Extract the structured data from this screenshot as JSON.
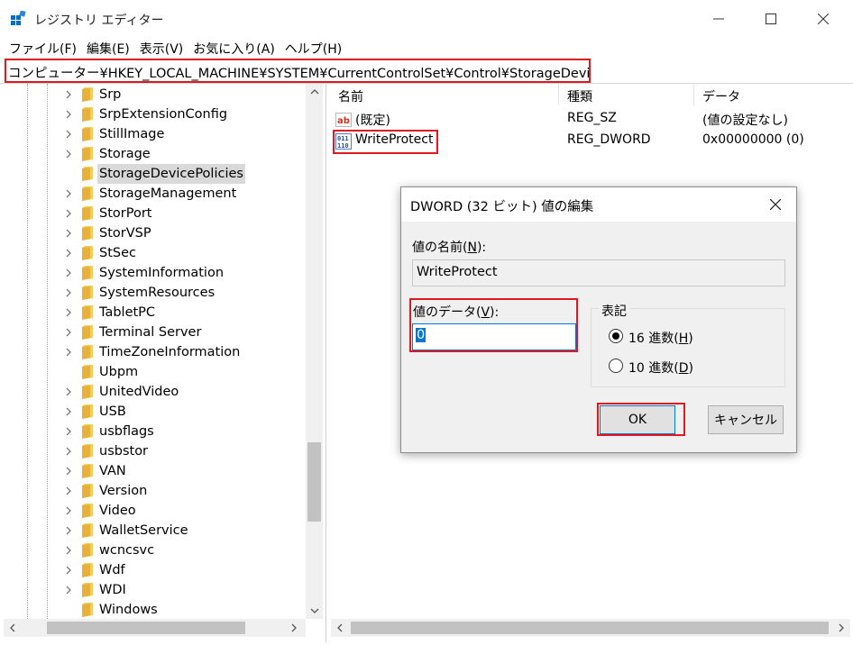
{
  "window": {
    "title": "レジストリ エディター",
    "icon": "regedit-icon"
  },
  "menu": [
    {
      "label": "ファイル(F)"
    },
    {
      "label": "編集(E)"
    },
    {
      "label": "表示(V)"
    },
    {
      "label": "お気に入り(A)"
    },
    {
      "label": "ヘルプ(H)"
    }
  ],
  "address": {
    "path": "コンピューター¥HKEY_LOCAL_MACHINE¥SYSTEM¥CurrentControlSet¥Control¥StorageDevicePolicies"
  },
  "tree": {
    "items": [
      {
        "label": "Srp",
        "expandable": true
      },
      {
        "label": "SrpExtensionConfig",
        "expandable": true
      },
      {
        "label": "StillImage",
        "expandable": true
      },
      {
        "label": "Storage",
        "expandable": true
      },
      {
        "label": "StorageDevicePolicies",
        "expandable": false,
        "selected": true
      },
      {
        "label": "StorageManagement",
        "expandable": true
      },
      {
        "label": "StorPort",
        "expandable": true
      },
      {
        "label": "StorVSP",
        "expandable": true
      },
      {
        "label": "StSec",
        "expandable": true
      },
      {
        "label": "SystemInformation",
        "expandable": true
      },
      {
        "label": "SystemResources",
        "expandable": true
      },
      {
        "label": "TabletPC",
        "expandable": true
      },
      {
        "label": "Terminal Server",
        "expandable": true
      },
      {
        "label": "TimeZoneInformation",
        "expandable": true
      },
      {
        "label": "Ubpm",
        "expandable": false
      },
      {
        "label": "UnitedVideo",
        "expandable": true
      },
      {
        "label": "USB",
        "expandable": true
      },
      {
        "label": "usbflags",
        "expandable": true
      },
      {
        "label": "usbstor",
        "expandable": true
      },
      {
        "label": "VAN",
        "expandable": true
      },
      {
        "label": "Version",
        "expandable": true
      },
      {
        "label": "Video",
        "expandable": true
      },
      {
        "label": "WalletService",
        "expandable": true
      },
      {
        "label": "wcncsvc",
        "expandable": true
      },
      {
        "label": "Wdf",
        "expandable": true
      },
      {
        "label": "WDI",
        "expandable": true
      },
      {
        "label": "Windows",
        "expandable": false
      }
    ]
  },
  "list": {
    "headers": {
      "name": "名前",
      "type": "種類",
      "data": "データ"
    },
    "rows": [
      {
        "icon": "string-value-icon",
        "name": "(既定)",
        "type": "REG_SZ",
        "data": "(値の設定なし)"
      },
      {
        "icon": "binary-value-icon",
        "name": "WriteProtect",
        "type": "REG_DWORD",
        "data": "0x00000000 (0)"
      }
    ]
  },
  "dialog": {
    "title": "DWORD (32 ビット) 値の編集",
    "name_label_pre": "値の名前(",
    "name_label_key": "N",
    "name_label_post": "):",
    "name_value": "WriteProtect",
    "data_label_pre": "値のデータ(",
    "data_label_key": "V",
    "data_label_post": "):",
    "data_value": "0",
    "base_label": "表記",
    "radio_hex_pre": "16 進数(",
    "radio_hex_key": "H",
    "radio_hex_post": ")",
    "radio_dec_pre": "10 進数(",
    "radio_dec_key": "D",
    "radio_dec_post": ")",
    "selected_base": "hex",
    "ok_label": "OK",
    "cancel_label": "キャンセル"
  },
  "colors": {
    "highlight": "#e0191e",
    "folder": "#f1c243",
    "selection": "#0078d7"
  }
}
